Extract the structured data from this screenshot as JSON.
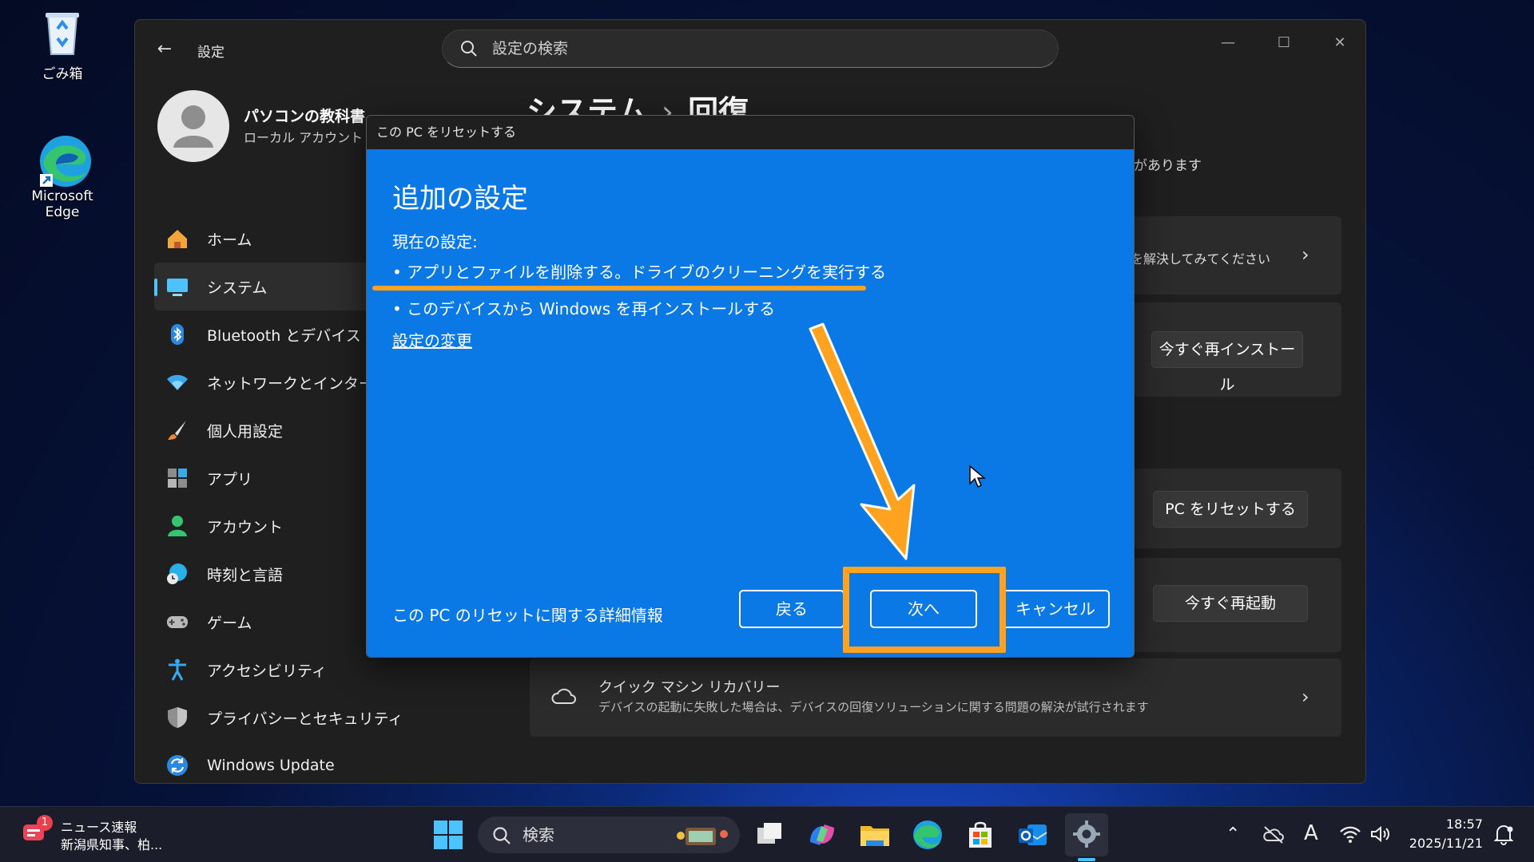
{
  "desktop": {
    "recycle_bin": "ごみ箱",
    "edge": "Microsoft Edge"
  },
  "window": {
    "app_title": "設定",
    "search_placeholder": "設定の検索",
    "minimize": "—",
    "maximize": "☐",
    "close": "✕"
  },
  "profile": {
    "name": "パソコンの教科書",
    "account_type": "ローカル アカウント"
  },
  "sidebar": {
    "items": [
      {
        "label": "ホーム"
      },
      {
        "label": "システム"
      },
      {
        "label": "Bluetooth とデバイス"
      },
      {
        "label": "ネットワークとインターネット"
      },
      {
        "label": "個人用設定"
      },
      {
        "label": "アプリ"
      },
      {
        "label": "アカウント"
      },
      {
        "label": "時刻と言語"
      },
      {
        "label": "ゲーム"
      },
      {
        "label": "アクセシビリティ"
      },
      {
        "label": "プライバシーとセキュリティ"
      },
      {
        "label": "Windows Update"
      }
    ]
  },
  "main": {
    "breadcrumb_parent": "システム",
    "breadcrumb_sep": "›",
    "breadcrumb_current": "回復",
    "partial_top": "があります",
    "troubleshoot_partial": "を解決してみてください",
    "reinstall_button": "今すぐ再インストール",
    "reset_button": "PC をリセットする",
    "restart_button": "今すぐ再起動",
    "quick_recovery_title": "クイック マシン リカバリー",
    "quick_recovery_desc": "デバイスの起動に失敗した場合は、デバイスの回復ソリューションに関する問題の解決が試行されます"
  },
  "dialog": {
    "title": "この PC をリセットする",
    "heading": "追加の設定",
    "current_label": "現在の設定:",
    "bullets": [
      "• アプリとファイルを削除する。ドライブのクリーニングを実行する",
      "• このデバイスから Windows を再インストールする"
    ],
    "change_link": "設定の変更",
    "info_link": "この PC のリセットに関する詳細情報",
    "back_button": "戻る",
    "next_button": "次へ",
    "cancel_button": "キャンセル"
  },
  "taskbar": {
    "news_badge": "1",
    "news_title": "ニュース速報",
    "news_sub": "新潟県知事、柏...",
    "search_label": "検索",
    "ime": "A",
    "time": "18:57",
    "date": "2025/11/21"
  }
}
